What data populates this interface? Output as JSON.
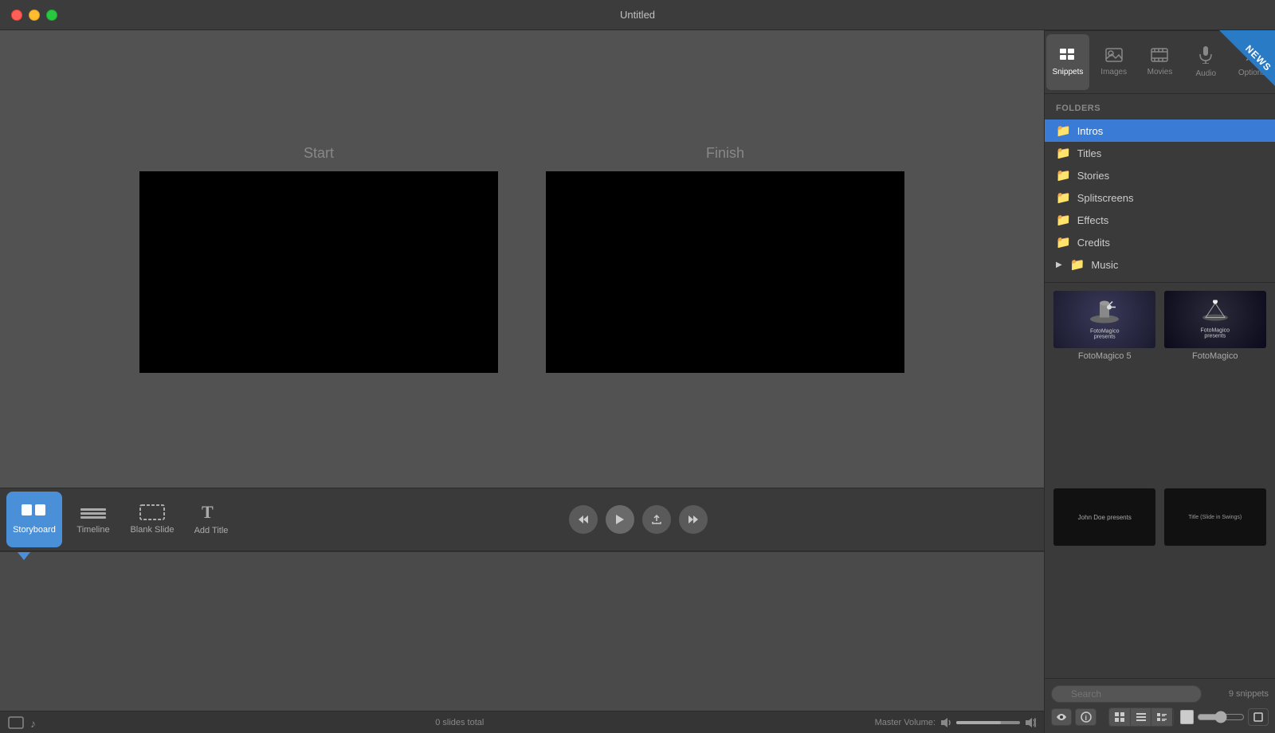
{
  "window": {
    "title": "Untitled"
  },
  "preview": {
    "start_label": "Start",
    "finish_label": "Finish"
  },
  "toolbar": {
    "storyboard_label": "Storyboard",
    "timeline_label": "Timeline",
    "blank_slide_label": "Blank Slide",
    "add_title_label": "Add Title"
  },
  "transport": {
    "rewind_label": "⏪",
    "play_label": "▶",
    "share_label": "↗",
    "fastforward_label": "⏩"
  },
  "right_tabs": {
    "snippets_label": "Snippets",
    "images_label": "Images",
    "movies_label": "Movies",
    "audio_label": "Audio",
    "options_label": "Options"
  },
  "folders": {
    "header": "FOLDERS",
    "items": [
      {
        "name": "Intros",
        "selected": true
      },
      {
        "name": "Titles",
        "selected": false
      },
      {
        "name": "Stories",
        "selected": false
      },
      {
        "name": "Splitscreens",
        "selected": false
      },
      {
        "name": "Effects",
        "selected": false
      },
      {
        "name": "Credits",
        "selected": false
      },
      {
        "name": "Music",
        "selected": false,
        "has_arrow": true
      }
    ]
  },
  "snippets": {
    "count_label": "9 snippets",
    "search_placeholder": "Search",
    "items": [
      {
        "label": "FotoMagico 5",
        "type": "logo1"
      },
      {
        "label": "FotoMagico",
        "type": "logo2"
      },
      {
        "label": "",
        "type": "dark1"
      },
      {
        "label": "",
        "type": "dark2"
      }
    ]
  },
  "statusbar": {
    "slides_count": "0 slides total",
    "volume_label": "Master Volume:"
  }
}
